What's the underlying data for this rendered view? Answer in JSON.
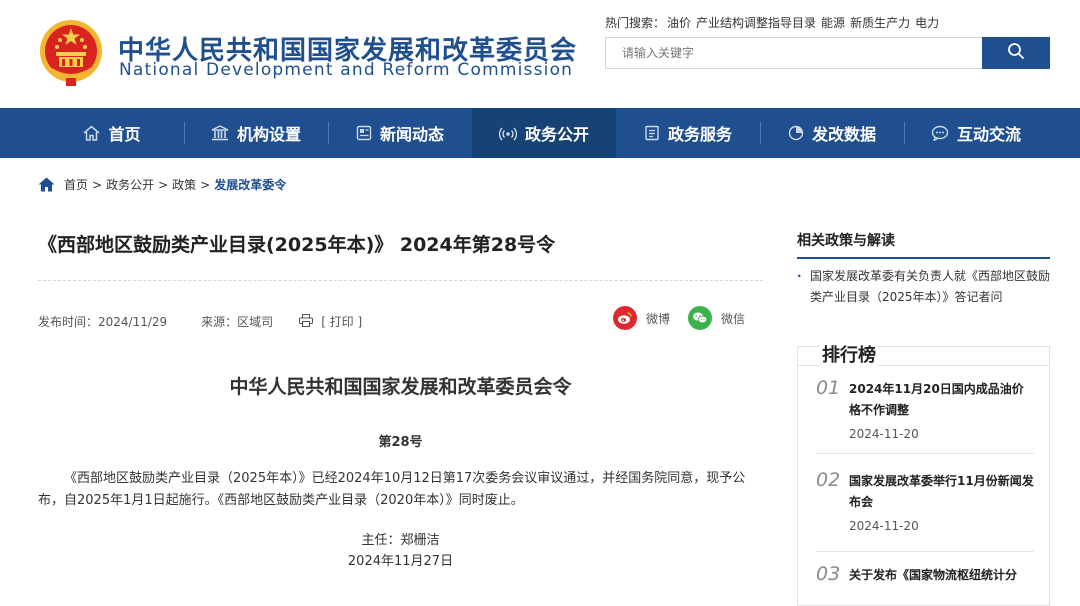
{
  "header": {
    "title_cn": "中华人民共和国国家发展和改革委员会",
    "title_en": "National Development and Reform Commission",
    "hot_label": "热门搜索：",
    "hot_terms": [
      "油价",
      "产业结构调整指导目录",
      "能源",
      "新质生产力",
      "电力"
    ],
    "search_placeholder": "请输入关键字"
  },
  "nav": {
    "items": [
      {
        "label": "首页",
        "icon": "home-icon"
      },
      {
        "label": "机构设置",
        "icon": "institution-icon"
      },
      {
        "label": "新闻动态",
        "icon": "news-icon"
      },
      {
        "label": "政务公开",
        "icon": "broadcast-icon",
        "active": true
      },
      {
        "label": "政务服务",
        "icon": "service-icon"
      },
      {
        "label": "发改数据",
        "icon": "chart-icon"
      },
      {
        "label": "互动交流",
        "icon": "chat-icon"
      }
    ]
  },
  "breadcrumb": {
    "items": [
      "首页",
      "政务公开",
      "政策"
    ],
    "separator": ">",
    "current": "发展改革委令"
  },
  "article": {
    "title": "《西部地区鼓励类产业目录(2025年本)》 2024年第28号令",
    "publish_time": "发布时间：2024/11/29",
    "source": "来源：区域司",
    "print_label": "[ 打印 ]",
    "share_weibo": "微博",
    "share_wechat": "微信",
    "order_title": "中华人民共和国国家发展和改革委员会令",
    "order_no": "第28号",
    "body": "《西部地区鼓励类产业目录（2025年本）》已经2024年10月12日第17次委务会议审议通过，并经国务院同意，现予公布，自2025年1月1日起施行。《西部地区鼓励类产业目录（2020年本）》同时废止。",
    "signer": "主任：郑栅洁",
    "sign_date": "2024年11月27日"
  },
  "sidebar": {
    "related_title": "相关政策与解读",
    "related_items": [
      "国家发展改革委有关负责人就《西部地区鼓励类产业目录（2025年本）》答记者问"
    ],
    "rank_title": "排行榜",
    "rank_items": [
      {
        "num": "01",
        "title": "2024年11月20日国内成品油价格不作调整",
        "date": "2024-11-20"
      },
      {
        "num": "02",
        "title": "国家发展改革委举行11月份新闻发布会",
        "date": "2024-11-20"
      },
      {
        "num": "03",
        "title": "关于发布《国家物流枢纽统计分"
      }
    ]
  },
  "colors": {
    "brand_blue": "#1f4f8f",
    "nav_active": "#174275",
    "weibo_red": "#e0292f",
    "wechat_green": "#3bb34a"
  }
}
